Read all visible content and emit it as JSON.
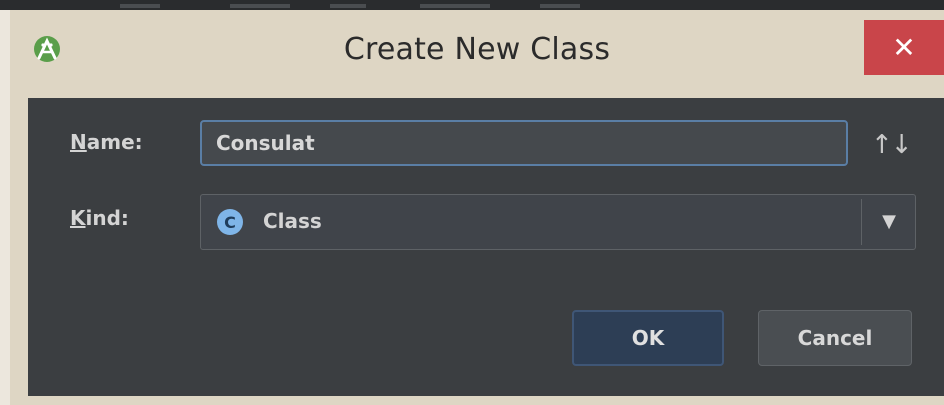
{
  "dialog": {
    "title": "Create New Class",
    "close_glyph": "✕",
    "app_icon": "android-studio-icon"
  },
  "form": {
    "name": {
      "mnemonic": "N",
      "label_rest": "ame:",
      "value": "Consulat"
    },
    "kind": {
      "mnemonic": "K",
      "label_rest": "ind:",
      "icon_letter": "C",
      "value": "Class"
    },
    "sort_glyph": "↑↓"
  },
  "buttons": {
    "ok_label": "OK",
    "cancel_label": "Cancel"
  },
  "colors": {
    "titlebar": "#ded6c4",
    "content_bg": "#3b3e41",
    "close_bg": "#c9454a",
    "focus_border": "#5a7ea5",
    "ok_bg": "#2d3e55",
    "class_icon_bg": "#7fb5e8"
  }
}
